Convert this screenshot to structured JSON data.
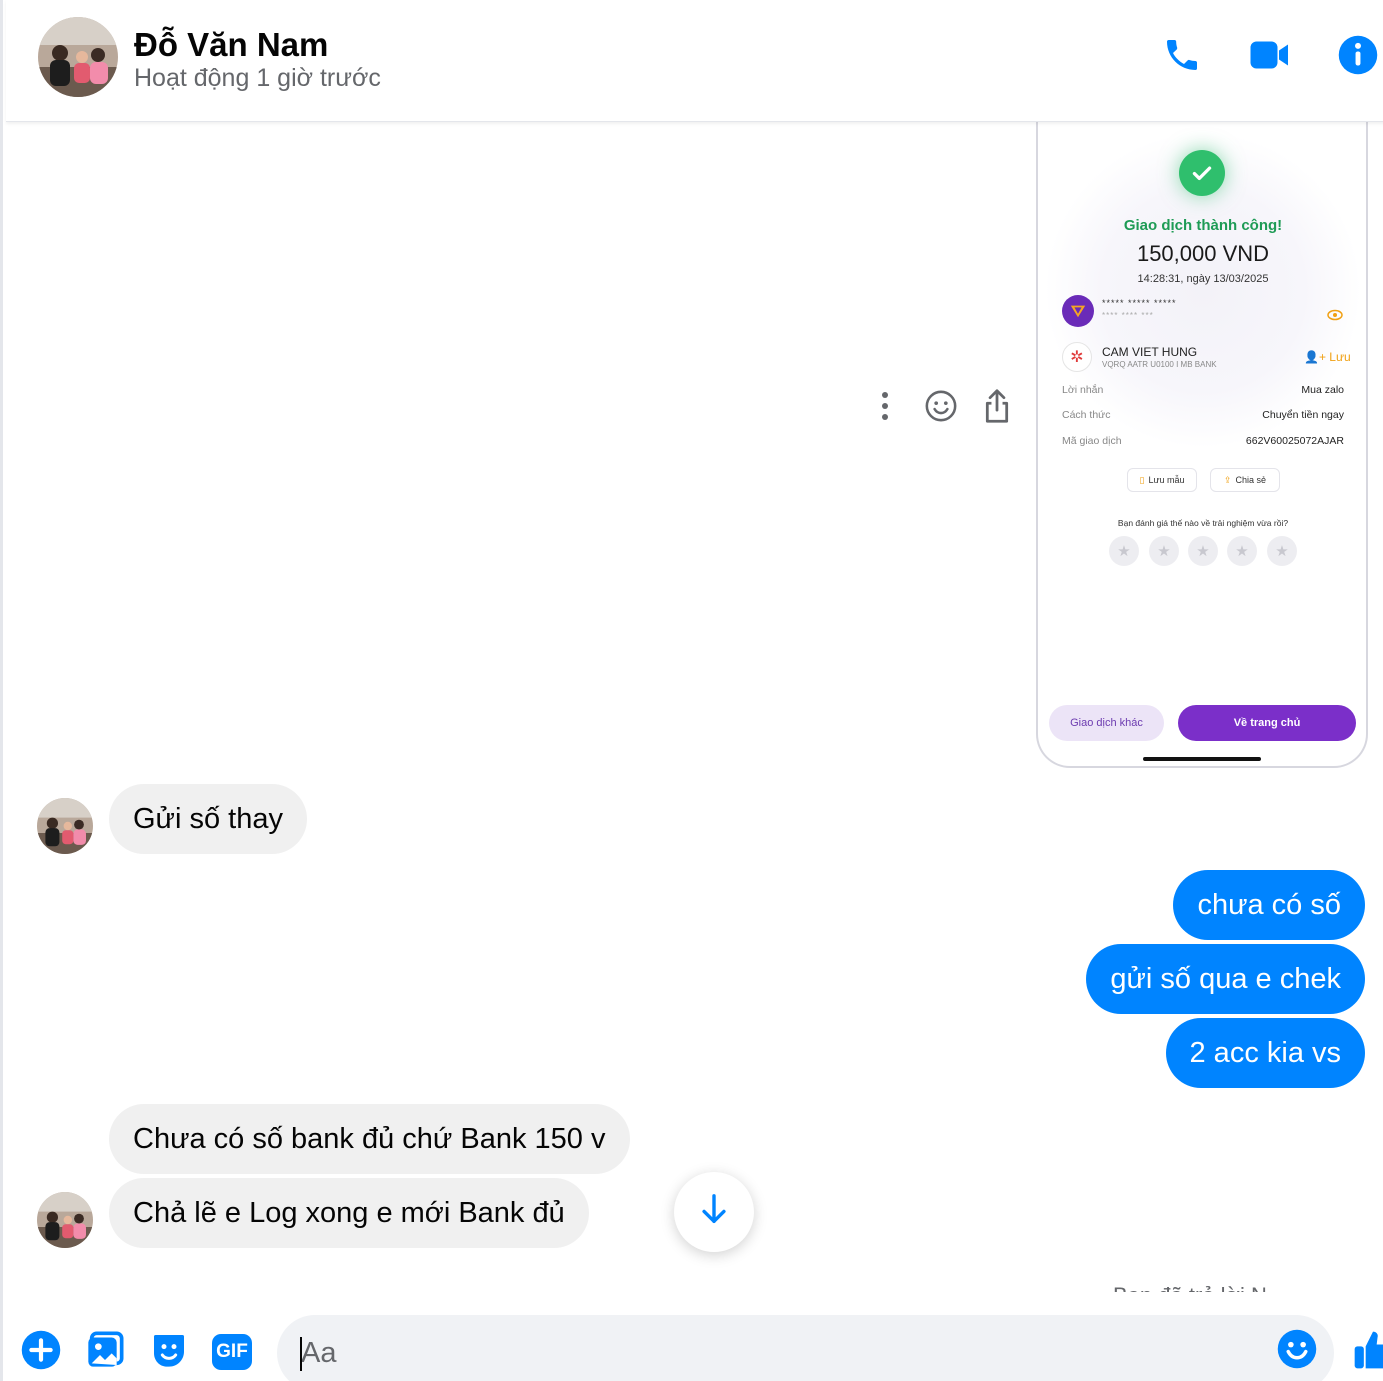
{
  "header": {
    "name": "Đỗ Văn Nam",
    "status": "Hoạt động 1 giờ trước",
    "colors": {
      "accent": "#0084ff"
    },
    "icons": [
      "phone-icon",
      "video-camera-icon",
      "info-icon"
    ]
  },
  "shared_image": {
    "success_text": "Giao dịch thành công!",
    "amount": "150,000 VND",
    "datetime": "14:28:31, ngày 13/03/2025",
    "source_masked": "***** ***** *****",
    "source_masked_sub": "**** **** ***",
    "recipient_name": "CAM VIET HUNG",
    "recipient_sub": "VQRQ AATR U0100 I MB BANK",
    "save_label": "Lưu",
    "rows": [
      {
        "label": "Lời nhắn",
        "value": "Mua zalo"
      },
      {
        "label": "Cách thức",
        "value": "Chuyển tiền ngay"
      },
      {
        "label": "Mã giao dịch",
        "value": "662V60025072AJAR"
      }
    ],
    "save_template_label": "Lưu mẫu",
    "share_label": "Chia sẻ",
    "rating_question": "Bạn đánh giá thế nào về trải nghiệm vừa rồi?",
    "rating_stars": 5,
    "other_transaction_label": "Giao dịch khác",
    "home_label": "Về trang chủ",
    "colors": {
      "success": "#2fbf6d",
      "brand": "#7b2fc9"
    }
  },
  "messages": [
    {
      "direction": "in",
      "text": "Gửi số thay"
    },
    {
      "direction": "out",
      "text": "chưa có số"
    },
    {
      "direction": "out",
      "text": "gửi số qua e chek"
    },
    {
      "direction": "out",
      "text": "2 acc kia vs"
    },
    {
      "direction": "in",
      "text": "Chưa có số bank đủ chứ Bank 150 v"
    },
    {
      "direction": "in",
      "text": "Chả lẽ e Log xong e mới Bank đủ"
    }
  ],
  "clipped_notice": "Bạn đã trả lời N...",
  "composer": {
    "placeholder": "Aa",
    "icons": [
      "plus-icon",
      "image-icon",
      "sticker-icon",
      "gif-icon",
      "emoji-icon",
      "thumbs-up-icon"
    ],
    "gif_label": "GIF"
  }
}
